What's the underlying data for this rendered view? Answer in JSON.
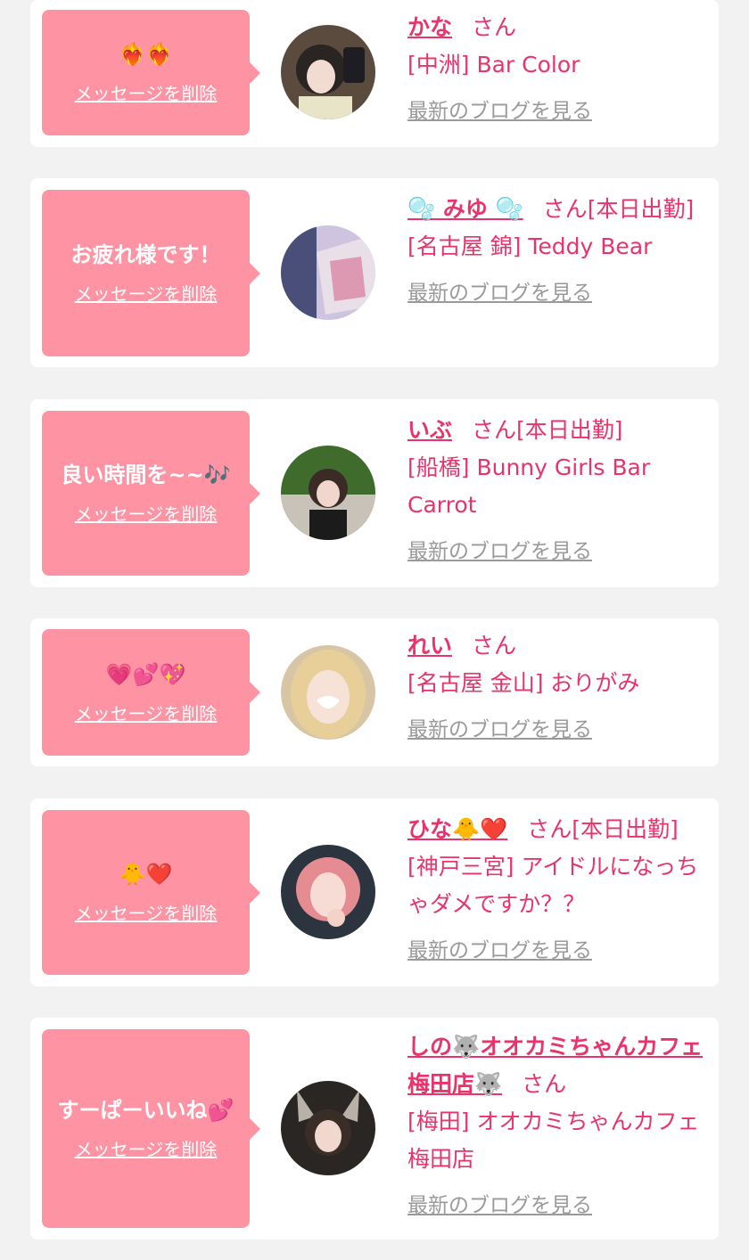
{
  "delete_label": "メッセージを削除",
  "blog_label": "最新のブログを見る",
  "san_label": "さん",
  "items": [
    {
      "message": "❤‍🔥❤‍🔥",
      "name": "かな",
      "suffix": "",
      "area": "[中洲] Bar Color"
    },
    {
      "message": "お疲れ様です！",
      "name": "🫧 みゆ 🫧",
      "suffix": "[本日出勤]",
      "area": "[名古屋 錦] Teddy Bear"
    },
    {
      "message": "良い時間を~~🎶",
      "name": "いぶ",
      "suffix": "[本日出勤]",
      "area": "[船橋] Bunny Girls Bar Carrot"
    },
    {
      "message": "💗💕💖",
      "name": "れい",
      "suffix": "",
      "area": "[名古屋 金山] おりがみ"
    },
    {
      "message": "🐥❤️",
      "name": "ひな🐥❤️",
      "suffix": "[本日出勤]",
      "area": "[神戸三宮] アイドルになっちゃダメですか？？"
    },
    {
      "message": "すーぱーいいね💕",
      "name": "しの🐺オオカミちゃんカフェ梅田店🐺",
      "suffix": "",
      "area": "[梅田] オオカミちゃんカフェ梅田店"
    }
  ]
}
